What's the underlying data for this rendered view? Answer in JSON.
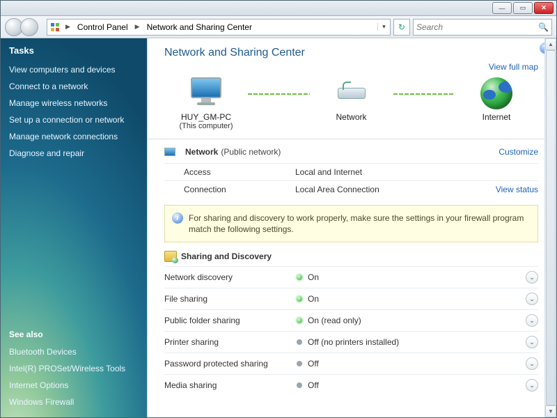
{
  "window": {
    "minimize_tip": "Minimize",
    "maximize_tip": "Maximize",
    "close_tip": "Close"
  },
  "breadcrumb": {
    "root": "Control Panel",
    "page": "Network and Sharing Center"
  },
  "search": {
    "placeholder": "Search"
  },
  "sidebar": {
    "tasks_heading": "Tasks",
    "links": [
      "View computers and devices",
      "Connect to a network",
      "Manage wireless networks",
      "Set up a connection or network",
      "Manage network connections",
      "Diagnose and repair"
    ],
    "seealso_heading": "See also",
    "seealso": [
      "Bluetooth Devices",
      "Intel(R) PROSet/Wireless Tools",
      "Internet Options",
      "Windows Firewall"
    ]
  },
  "page": {
    "title": "Network and Sharing Center",
    "view_full_map": "View full map",
    "nodes": {
      "this_pc_name": "HUY_GM-PC",
      "this_pc_sub": "(This computer)",
      "network_label": "Network",
      "internet_label": "Internet"
    },
    "network_section": {
      "name": "Network",
      "type": "(Public network)",
      "customize": "Customize",
      "rows": {
        "access_k": "Access",
        "access_v": "Local and Internet",
        "connection_k": "Connection",
        "connection_v": "Local Area Connection",
        "view_status": "View status"
      }
    },
    "info": "For sharing and discovery to work properly, make sure the settings in your firewall program match the following settings.",
    "sharing_heading": "Sharing and Discovery",
    "sharing_rows": [
      {
        "k": "Network discovery",
        "v": "On",
        "state": "on"
      },
      {
        "k": "File sharing",
        "v": "On",
        "state": "on"
      },
      {
        "k": "Public folder sharing",
        "v": "On (read only)",
        "state": "on"
      },
      {
        "k": "Printer sharing",
        "v": "Off (no printers installed)",
        "state": "off"
      },
      {
        "k": "Password protected sharing",
        "v": "Off",
        "state": "off"
      },
      {
        "k": "Media sharing",
        "v": "Off",
        "state": "off"
      }
    ]
  }
}
